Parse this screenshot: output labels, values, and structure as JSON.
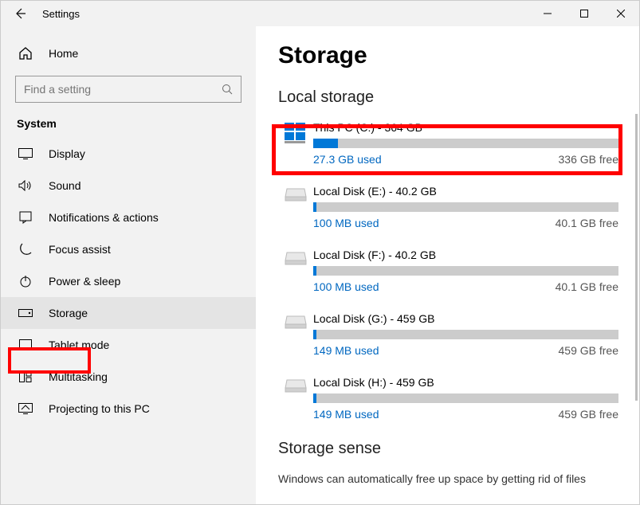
{
  "window": {
    "title": "Settings"
  },
  "sidebar": {
    "home": "Home",
    "search_placeholder": "Find a setting",
    "section": "System",
    "items": [
      {
        "label": "Display",
        "icon": "display"
      },
      {
        "label": "Sound",
        "icon": "sound"
      },
      {
        "label": "Notifications & actions",
        "icon": "notifications"
      },
      {
        "label": "Focus assist",
        "icon": "focus"
      },
      {
        "label": "Power & sleep",
        "icon": "power"
      },
      {
        "label": "Storage",
        "icon": "storage",
        "active": true
      },
      {
        "label": "Tablet mode",
        "icon": "tablet"
      },
      {
        "label": "Multitasking",
        "icon": "multitask"
      },
      {
        "label": "Projecting to this PC",
        "icon": "project"
      }
    ]
  },
  "content": {
    "title": "Storage",
    "local_storage_heading": "Local storage",
    "drives": [
      {
        "name": "This PC (C:) - 364 GB",
        "used": "27.3 GB used",
        "free": "336 GB free",
        "pct": 8,
        "primary": true
      },
      {
        "name": "Local Disk (E:) - 40.2 GB",
        "used": "100 MB used",
        "free": "40.1 GB free",
        "pct": 1
      },
      {
        "name": "Local Disk (F:) - 40.2 GB",
        "used": "100 MB used",
        "free": "40.1 GB free",
        "pct": 1
      },
      {
        "name": "Local Disk (G:) - 459 GB",
        "used": "149 MB used",
        "free": "459 GB free",
        "pct": 1
      },
      {
        "name": "Local Disk (H:) - 459 GB",
        "used": "149 MB used",
        "free": "459 GB free",
        "pct": 1
      }
    ],
    "storage_sense_heading": "Storage sense",
    "storage_sense_desc": "Windows can automatically free up space by getting rid of files"
  }
}
